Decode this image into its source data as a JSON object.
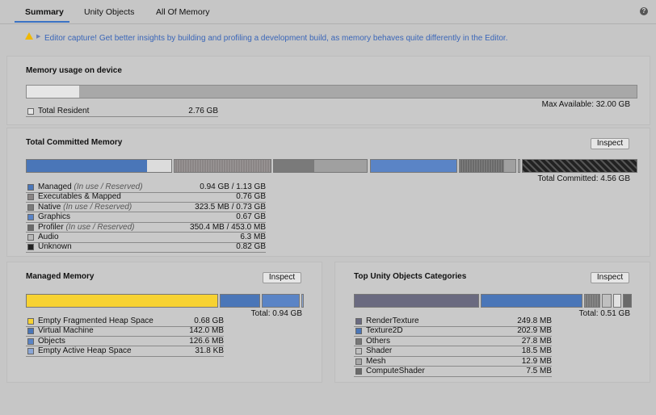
{
  "tabs": [
    {
      "label": "Summary",
      "active": true
    },
    {
      "label": "Unity Objects",
      "active": false
    },
    {
      "label": "All Of Memory",
      "active": false
    }
  ],
  "help_icon": "help-icon",
  "banner": {
    "icon": "warning-icon",
    "text": "Editor capture! Get better insights by building and profiling a development build, as memory behaves quite differently in the Editor."
  },
  "device": {
    "title": "Memory usage on device",
    "max_available": "Max Available: 32.00 GB",
    "resident_fraction": 0.086,
    "legend": [
      {
        "name": "Total Resident",
        "value": "2.76 GB",
        "color": "#e6e6e6"
      }
    ]
  },
  "committed": {
    "title": "Total Committed Memory",
    "inspect_label": "Inspect",
    "total": "Total Committed: 4.56 GB",
    "legend": [
      {
        "name": "Managed",
        "sub": "(In use / Reserved)",
        "value": "0.94 GB / 1.13 GB",
        "color": "#4a76b8"
      },
      {
        "name": "Executables & Mapped",
        "sub": "",
        "value": "0.76 GB",
        "color": "#8a8585"
      },
      {
        "name": "Native",
        "sub": "(In use / Reserved)",
        "value": "323.5 MB / 0.73 GB",
        "color": "#7a7a7a"
      },
      {
        "name": "Graphics",
        "sub": "",
        "value": "0.67 GB",
        "color": "#5a84c6"
      },
      {
        "name": "Profiler",
        "sub": "(In use / Reserved)",
        "value": "350.4 MB / 453.0 MB",
        "color": "#6a6a6a"
      },
      {
        "name": "Audio",
        "sub": "",
        "value": "6.3 MB",
        "color": "#b8b8b8"
      },
      {
        "name": "Unknown",
        "sub": "",
        "value": "0.82 GB",
        "color": "#222222"
      }
    ]
  },
  "managed": {
    "title": "Managed Memory",
    "inspect_label": "Inspect",
    "total": "Total: 0.94 GB",
    "legend": [
      {
        "name": "Empty Fragmented Heap Space",
        "value": "0.68 GB",
        "color": "#f7d232"
      },
      {
        "name": "Virtual Machine",
        "value": "142.0 MB",
        "color": "#4a76b8"
      },
      {
        "name": "Objects",
        "value": "126.6 MB",
        "color": "#5a84c6"
      },
      {
        "name": "Empty Active Heap Space",
        "value": "31.8 KB",
        "color": "#8aa6d6"
      }
    ]
  },
  "unity_objects": {
    "title": "Top Unity Objects Categories",
    "inspect_label": "Inspect",
    "total": "Total: 0.51 GB",
    "legend": [
      {
        "name": "RenderTexture",
        "value": "249.8 MB",
        "color": "#6a6a80"
      },
      {
        "name": "Texture2D",
        "value": "202.9 MB",
        "color": "#4a76b8"
      },
      {
        "name": "Others",
        "value": "27.8 MB",
        "color": "#777777"
      },
      {
        "name": "Shader",
        "value": "18.5 MB",
        "color": "#c0c0c0"
      },
      {
        "name": "Mesh",
        "value": "12.9 MB",
        "color": "#a8a8a8"
      },
      {
        "name": "ComputeShader",
        "value": "7.5 MB",
        "color": "#6a6a6a"
      }
    ]
  }
}
